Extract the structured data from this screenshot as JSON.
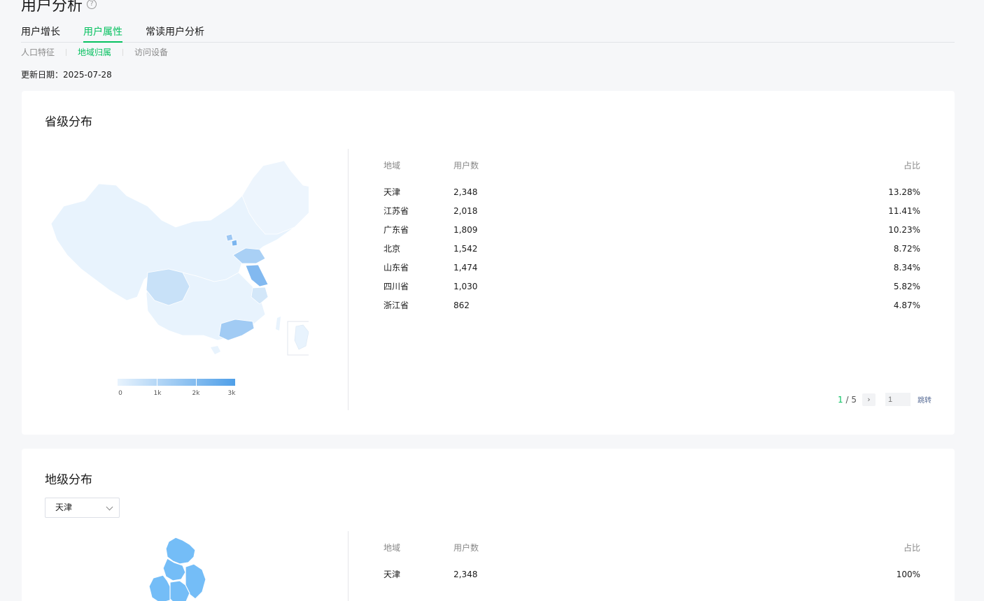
{
  "page": {
    "title": "用户分析"
  },
  "tabs": [
    "用户增长",
    "用户属性",
    "常读用户分析"
  ],
  "subtabs": [
    "人口特征",
    "地域归属",
    "访问设备"
  ],
  "update": {
    "label": "更新日期：",
    "date": "2025-07-28"
  },
  "province": {
    "title": "省级分布",
    "legend": [
      "0",
      "1k",
      "2k",
      "3k"
    ],
    "table": {
      "headers": [
        "地域",
        "用户数",
        "占比"
      ],
      "rows": [
        [
          "天津",
          "2,348",
          "13.28%"
        ],
        [
          "江苏省",
          "2,018",
          "11.41%"
        ],
        [
          "广东省",
          "1,809",
          "10.23%"
        ],
        [
          "北京",
          "1,542",
          "8.72%"
        ],
        [
          "山东省",
          "1,474",
          "8.34%"
        ],
        [
          "四川省",
          "1,030",
          "5.82%"
        ],
        [
          "浙江省",
          "862",
          "4.87%"
        ]
      ]
    },
    "pager": {
      "current": "1",
      "total": "/ 5",
      "input_placeholder": "1",
      "jump": "跳转"
    }
  },
  "city": {
    "title": "地级分布",
    "select_value": "天津",
    "table": {
      "headers": [
        "地域",
        "用户数",
        "占比"
      ],
      "rows": [
        [
          "天津",
          "2,348",
          "100%"
        ]
      ]
    }
  },
  "colors": {
    "accent": "#07c160",
    "map_low": "#e8f3fd",
    "map_high": "#4f9fe8",
    "city_fill": "#74bdf7"
  }
}
